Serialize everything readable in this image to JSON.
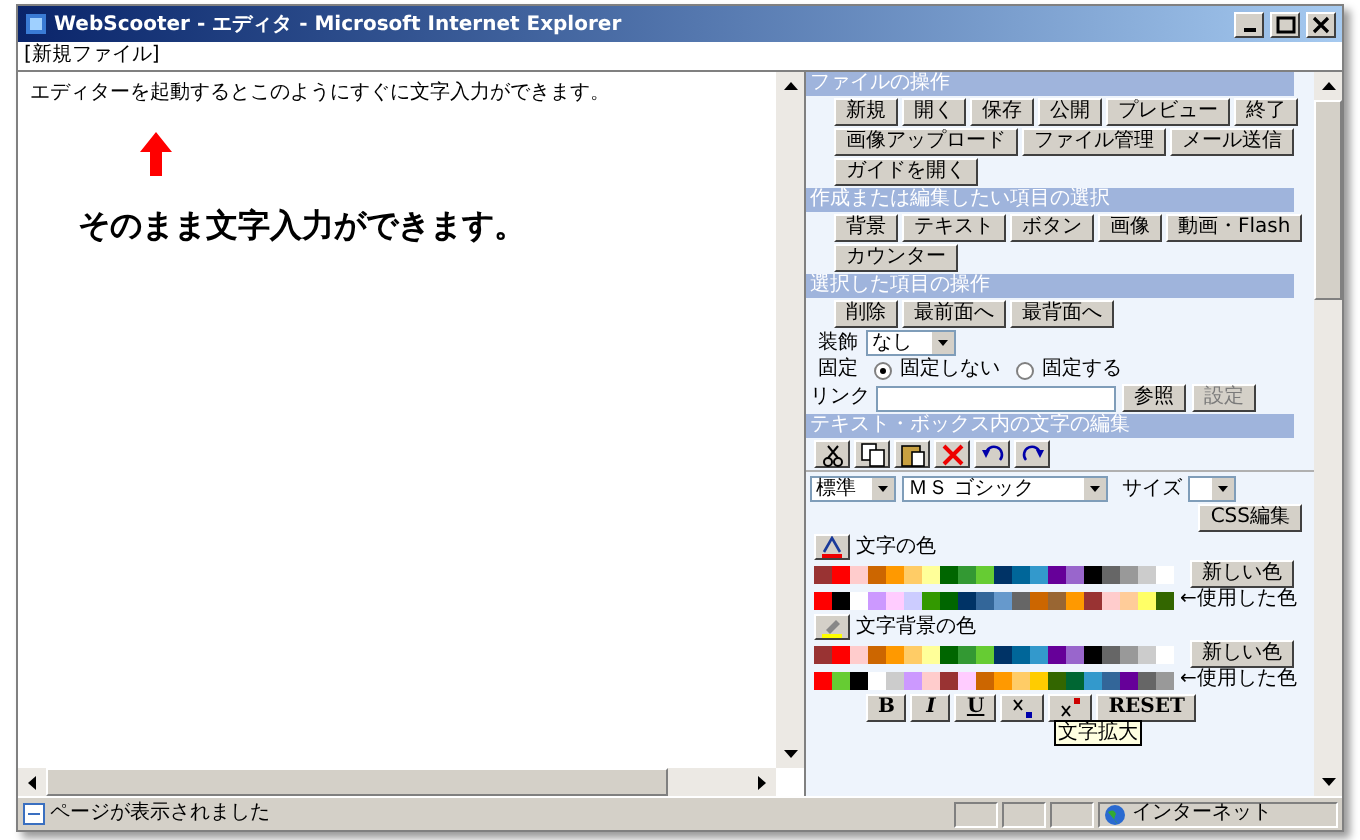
{
  "window": {
    "title": "WebScooter - エディタ - Microsoft Internet Explorer"
  },
  "file_label": "[新規ファイル]",
  "editor": {
    "text": "エディターを起動するとこのようにすぐに文字入力ができます。"
  },
  "annotation": {
    "text": "そのまま文字入力ができます。"
  },
  "side_panel": {
    "sections": [
      {
        "title": "ファイルの操作",
        "rows": [
          {
            "kind": "buttons",
            "buttons": [
              {
                "label": "新規"
              },
              {
                "label": "開く"
              },
              {
                "label": "保存"
              },
              {
                "label": "公開"
              },
              {
                "label": "プレビュー"
              },
              {
                "label": "終了"
              }
            ]
          },
          {
            "kind": "buttons",
            "buttons": [
              {
                "label": "画像アップロード"
              },
              {
                "label": "ファイル管理"
              },
              {
                "label": "メール送信"
              }
            ]
          },
          {
            "kind": "buttons",
            "buttons": [
              {
                "label": "ガイドを開く"
              }
            ]
          }
        ]
      },
      {
        "title": "作成または編集したい項目の選択",
        "rows": [
          {
            "kind": "buttons",
            "buttons": [
              {
                "label": "背景"
              },
              {
                "label": "テキスト"
              },
              {
                "label": "ボタン"
              },
              {
                "label": "画像"
              },
              {
                "label": "動画・Flash"
              }
            ]
          },
          {
            "kind": "buttons",
            "buttons": [
              {
                "label": "カウンター"
              }
            ]
          }
        ]
      },
      {
        "title": "選択した項目の操作",
        "rows": [
          {
            "kind": "buttons",
            "buttons": [
              {
                "label": "削除"
              },
              {
                "label": "最前面へ"
              },
              {
                "label": "最背面へ"
              }
            ]
          },
          {
            "kind": "select",
            "label": "装飾",
            "value": "なし"
          },
          {
            "kind": "radio",
            "label": "固定",
            "options": [
              {
                "label": "固定しない",
                "selected": true
              },
              {
                "label": "固定する",
                "selected": false
              }
            ]
          },
          {
            "kind": "link",
            "label": "リンク",
            "buttons": [
              {
                "label": "参照",
                "disabled": false
              },
              {
                "label": "設定",
                "disabled": true
              }
            ]
          }
        ]
      },
      {
        "title": "テキスト・ボックス内の文字の編集",
        "rows": [
          {
            "kind": "icons",
            "icons": [
              {
                "kind": "cut"
              },
              {
                "kind": "copy"
              },
              {
                "kind": "paste"
              },
              {
                "kind": "delete"
              },
              {
                "kind": "undo"
              },
              {
                "kind": "redo"
              }
            ]
          },
          {
            "kind": "font",
            "style": "標準",
            "font": "ＭＳ ゴシック",
            "size_label": "サイズ"
          },
          {
            "kind": "right_button",
            "label": "CSS編集"
          },
          {
            "kind": "text_palette",
            "label": "文字の色",
            "new_button": "新しい色",
            "used_label": "←使用した色",
            "colors": [
              {
                "color": "#993333"
              },
              {
                "color": "#ff0000"
              },
              {
                "color": "#ffcccc"
              },
              {
                "color": "#cc6600"
              },
              {
                "color": "#ff9900"
              },
              {
                "color": "#ffcc66"
              },
              {
                "color": "#ffff99"
              },
              {
                "color": "#006600"
              },
              {
                "color": "#339933"
              },
              {
                "color": "#66cc33"
              },
              {
                "color": "#003366"
              },
              {
                "color": "#006699"
              },
              {
                "color": "#3399cc"
              },
              {
                "color": "#660099"
              },
              {
                "color": "#9966cc"
              },
              {
                "color": "#000000"
              },
              {
                "color": "#666666"
              },
              {
                "color": "#999999"
              },
              {
                "color": "#cccccc"
              },
              {
                "color": "#ffffff"
              }
            ],
            "used_colors": [
              {
                "color": "#ff0000"
              },
              {
                "color": "#000000"
              },
              {
                "color": "#ffffff"
              },
              {
                "color": "#cc99ff"
              },
              {
                "color": "#ffccff"
              },
              {
                "color": "#ccccff"
              },
              {
                "color": "#339900"
              },
              {
                "color": "#006600"
              },
              {
                "color": "#003366"
              },
              {
                "color": "#336699"
              },
              {
                "color": "#6699cc"
              },
              {
                "color": "#666666"
              },
              {
                "color": "#cc6600"
              },
              {
                "color": "#996633"
              },
              {
                "color": "#ff9900"
              },
              {
                "color": "#993333"
              },
              {
                "color": "#ffcccc"
              },
              {
                "color": "#ffcc99"
              },
              {
                "color": "#ffff66"
              },
              {
                "color": "#336600"
              }
            ]
          },
          {
            "kind": "background_palette",
            "label": "文字背景の色",
            "new_button": "新しい色",
            "used_label": "←使用した色",
            "colors": [
              {
                "color": "#993333"
              },
              {
                "color": "#ff0000"
              },
              {
                "color": "#ffcccc"
              },
              {
                "color": "#cc6600"
              },
              {
                "color": "#ff9900"
              },
              {
                "color": "#ffcc66"
              },
              {
                "color": "#ffff99"
              },
              {
                "color": "#006600"
              },
              {
                "color": "#339933"
              },
              {
                "color": "#66cc33"
              },
              {
                "color": "#003366"
              },
              {
                "color": "#006699"
              },
              {
                "color": "#3399cc"
              },
              {
                "color": "#660099"
              },
              {
                "color": "#9966cc"
              },
              {
                "color": "#000000"
              },
              {
                "color": "#666666"
              },
              {
                "color": "#999999"
              },
              {
                "color": "#cccccc"
              },
              {
                "color": "#ffffff"
              }
            ],
            "used_colors": [
              {
                "color": "#ff0000"
              },
              {
                "color": "#66cc33"
              },
              {
                "color": "#000000"
              },
              {
                "color": "#ffffff"
              },
              {
                "color": "#cccccc"
              },
              {
                "color": "#cc99ff"
              },
              {
                "color": "#ffcccc"
              },
              {
                "color": "#993333"
              },
              {
                "color": "#ffccff"
              },
              {
                "color": "#cc6600"
              },
              {
                "color": "#ff9900"
              },
              {
                "color": "#ffcc66"
              },
              {
                "color": "#ffcc00"
              },
              {
                "color": "#336600"
              },
              {
                "color": "#006633"
              },
              {
                "color": "#3399cc"
              },
              {
                "color": "#336699"
              },
              {
                "color": "#660099"
              },
              {
                "color": "#666666"
              },
              {
                "color": "#999999"
              }
            ]
          },
          {
            "kind": "format",
            "buttons": [
              {
                "kind": "text",
                "label": "B"
              },
              {
                "kind": "text",
                "label": "I"
              },
              {
                "kind": "text",
                "label": "U"
              },
              {
                "kind": "subscript"
              },
              {
                "kind": "superscript"
              },
              {
                "kind": "text",
                "label": "RESET"
              }
            ],
            "tooltip": "文字拡大"
          }
        ]
      }
    ]
  },
  "status_bar": {
    "text": "ページが表示されました",
    "zone": "インターネット"
  }
}
